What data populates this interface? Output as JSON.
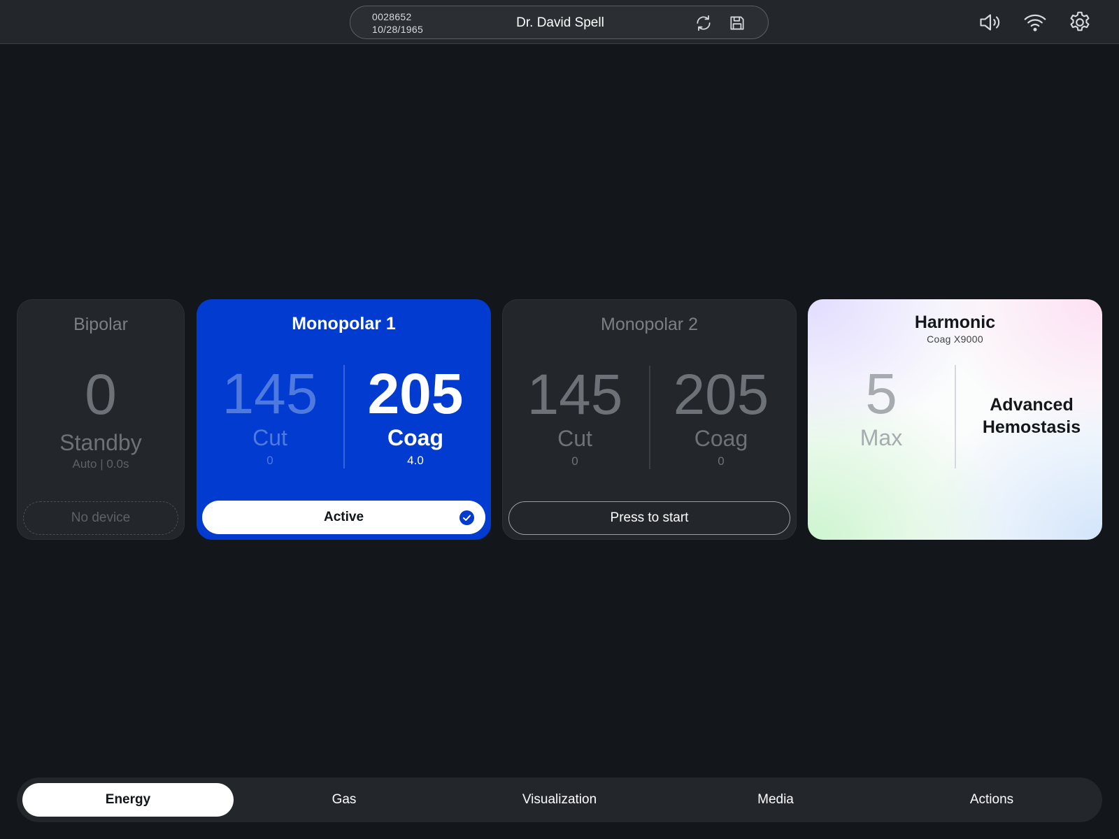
{
  "header": {
    "patient_id": "0028652",
    "patient_dob": "10/28/1965",
    "doctor": "Dr. David Spell",
    "icons": [
      "refresh-icon",
      "save-icon",
      "volume-icon",
      "wifi-icon",
      "settings-icon"
    ]
  },
  "cards": {
    "bipolar": {
      "title": "Bipolar",
      "value": "0",
      "mode": "Standby",
      "sub": "Auto | 0.0s",
      "device": "No device"
    },
    "monopolar1": {
      "title": "Monopolar 1",
      "cut_value": "145",
      "cut_label": "Cut",
      "cut_sub": "0",
      "coag_value": "205",
      "coag_label": "Coag",
      "coag_sub": "4.0",
      "button": "Active"
    },
    "monopolar2": {
      "title": "Monopolar 2",
      "cut_value": "145",
      "cut_label": "Cut",
      "cut_sub": "0",
      "coag_value": "205",
      "coag_label": "Coag",
      "coag_sub": "0",
      "button": "Press to start"
    },
    "harmonic": {
      "title": "Harmonic",
      "subtitle": "Coag X9000",
      "value": "5",
      "value_label": "Max",
      "mode_line1": "Advanced",
      "mode_line2": "Hemostasis"
    }
  },
  "nav": {
    "tabs": [
      {
        "label": "Energy",
        "selected": true
      },
      {
        "label": "Gas",
        "selected": false
      },
      {
        "label": "Visualization",
        "selected": false
      },
      {
        "label": "Media",
        "selected": false
      },
      {
        "label": "Actions",
        "selected": false
      }
    ]
  },
  "colors": {
    "background": "#13171b",
    "panel": "#23272c",
    "accent_blue": "#023bcf"
  }
}
